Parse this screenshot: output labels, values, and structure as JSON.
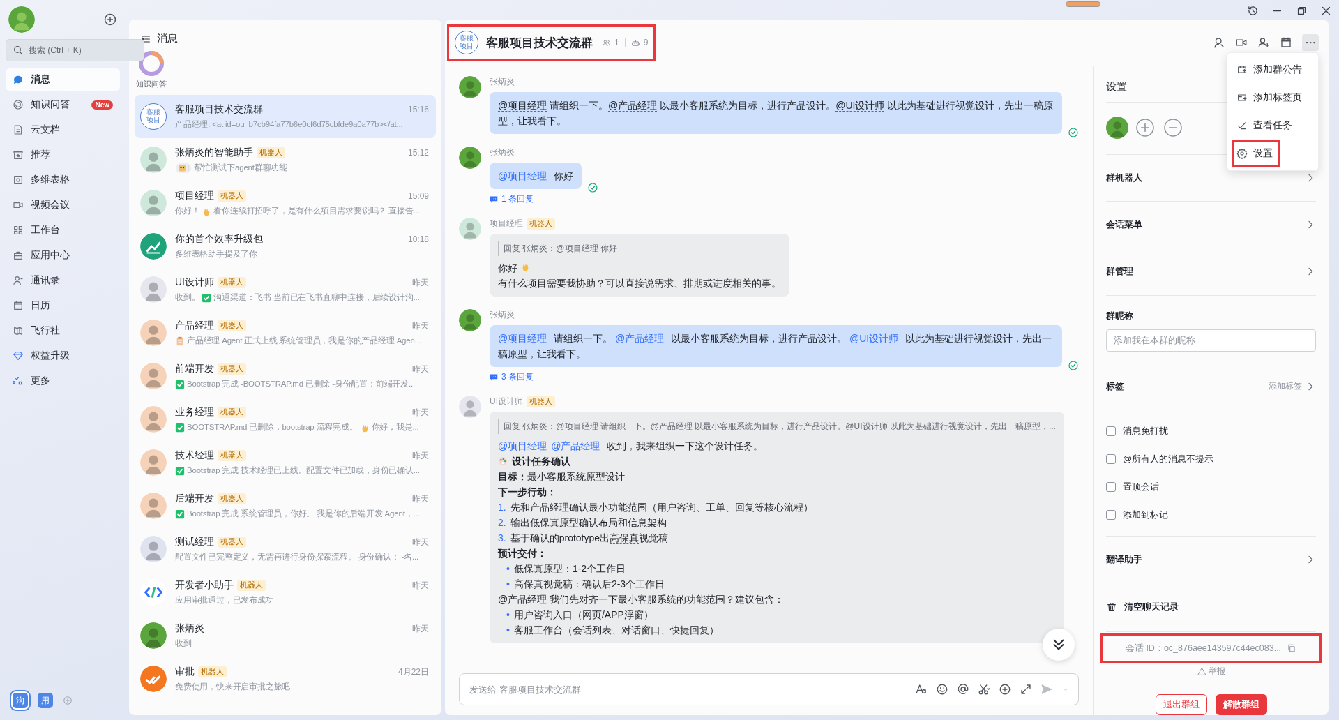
{
  "nav": {
    "search": {
      "placeholder": "搜索 (Ctrl + K)"
    },
    "items": [
      {
        "label": "消息",
        "selected": true
      },
      {
        "label": "知识问答",
        "selected": false,
        "badge": "New"
      },
      {
        "label": "云文档",
        "selected": false
      },
      {
        "label": "推荐",
        "selected": false
      },
      {
        "label": "多维表格",
        "selected": false
      },
      {
        "label": "视频会议",
        "selected": false
      },
      {
        "label": "工作台",
        "selected": false
      },
      {
        "label": "应用中心",
        "selected": false
      },
      {
        "label": "通讯录",
        "selected": false
      },
      {
        "label": "日历",
        "selected": false
      },
      {
        "label": "飞行社",
        "selected": false
      },
      {
        "label": "权益升级",
        "selected": false
      },
      {
        "label": "更多",
        "selected": false
      }
    ],
    "workspaces": [
      {
        "label": "沟",
        "selected": true
      },
      {
        "label": "用",
        "selected": false
      }
    ]
  },
  "list": {
    "title": "消息",
    "pinned": [
      {
        "label": "知识问答"
      }
    ],
    "conversations": [
      {
        "name": "客服项目技术交流群",
        "time": "15:16",
        "selected": true,
        "avatar": {
          "kind": "group",
          "lines": [
            "客服",
            "项目"
          ]
        },
        "preview": [
          {
            "kind": "text",
            "text": "产品经理: <at id=ou_b7cb94fa77b6e0cf6d75cbfde9a0a77b></at..."
          }
        ]
      },
      {
        "name": "张炳炎的智能助手",
        "tag": "机器人",
        "time": "15:12",
        "selected": false,
        "avatar": {
          "kind": "figure",
          "color": "#cfe8dc"
        },
        "preview": [
          {
            "kind": "bot"
          },
          {
            "kind": "text",
            "text": "帮忙测试下agent群聊功能"
          }
        ]
      },
      {
        "name": "项目经理",
        "tag": "机器人",
        "time": "15:09",
        "selected": false,
        "avatar": {
          "kind": "figure",
          "color": "#cfe8dc"
        },
        "preview": [
          {
            "kind": "text",
            "text": "你好！"
          },
          {
            "kind": "wave"
          },
          {
            "kind": "text",
            "text": "看你连续打招呼了，是有什么项目需求要说吗？ 直接告..."
          }
        ]
      },
      {
        "name": "你的首个效率升级包",
        "time": "10:18",
        "selected": false,
        "avatar": {
          "kind": "chart"
        },
        "preview": [
          {
            "kind": "text",
            "text": "多维表格助手提及了你"
          }
        ]
      },
      {
        "name": "UI设计师",
        "tag": "机器人",
        "time": "昨天",
        "selected": false,
        "avatar": {
          "kind": "figure",
          "color": "#e6e6ee"
        },
        "preview": [
          {
            "kind": "text",
            "text": "收到。"
          },
          {
            "kind": "check"
          },
          {
            "kind": "text",
            "text": "沟通渠道：飞书 当前已在飞书直聊中连接，后续设计沟..."
          }
        ]
      },
      {
        "name": "产品经理",
        "tag": "机器人",
        "time": "昨天",
        "selected": false,
        "avatar": {
          "kind": "figure",
          "color": "#f5d2b8"
        },
        "preview": [
          {
            "kind": "doc"
          },
          {
            "kind": "text",
            "text": "产品经理 Agent 正式上线 系统管理员，我是你的产品经理 Agen..."
          }
        ]
      },
      {
        "name": "前端开发",
        "tag": "机器人",
        "time": "昨天",
        "selected": false,
        "avatar": {
          "kind": "figure",
          "color": "#f5d2b8"
        },
        "preview": [
          {
            "kind": "check"
          },
          {
            "kind": "text",
            "text": "Bootstrap 完成 -BOOTSTRAP.md 已删除 -身份配置：前端开发..."
          }
        ]
      },
      {
        "name": "业务经理",
        "tag": "机器人",
        "time": "昨天",
        "selected": false,
        "avatar": {
          "kind": "figure",
          "color": "#f5d2b8"
        },
        "preview": [
          {
            "kind": "check"
          },
          {
            "kind": "text",
            "text": "BOOTSTRAP.md 已删除，bootstrap 流程完成。"
          },
          {
            "kind": "wave"
          },
          {
            "kind": "text",
            "text": "你好，我是..."
          }
        ]
      },
      {
        "name": "技术经理",
        "tag": "机器人",
        "time": "昨天",
        "selected": false,
        "avatar": {
          "kind": "figure",
          "color": "#f5d2b8"
        },
        "preview": [
          {
            "kind": "check"
          },
          {
            "kind": "text",
            "text": "Bootstrap 完成 技术经理已上线。配置文件已加载，身份已确认..."
          }
        ]
      },
      {
        "name": "后端开发",
        "tag": "机器人",
        "time": "昨天",
        "selected": false,
        "avatar": {
          "kind": "figure",
          "color": "#f5d2b8"
        },
        "preview": [
          {
            "kind": "check"
          },
          {
            "kind": "text",
            "text": "Bootstrap 完成 系统管理员，你好。 我是你的后端开发 Agent，..."
          }
        ]
      },
      {
        "name": "测试经理",
        "tag": "机器人",
        "time": "昨天",
        "selected": false,
        "avatar": {
          "kind": "figure",
          "color": "#dfe3f0"
        },
        "preview": [
          {
            "kind": "text",
            "text": "配置文件已完整定义，无需再进行身份探索流程。 身份确认： -名..."
          }
        ]
      },
      {
        "name": "开发者小助手",
        "tag": "机器人",
        "time": "昨天",
        "selected": false,
        "avatar": {
          "kind": "code"
        },
        "preview": [
          {
            "kind": "text",
            "text": "应用审批通过，已发布成功"
          }
        ]
      },
      {
        "name": "张炳炎",
        "time": "昨天",
        "selected": false,
        "avatar": {
          "kind": "figure",
          "color": "#5aa63c"
        },
        "preview": [
          {
            "kind": "text",
            "text": "收到"
          }
        ]
      },
      {
        "name": "审批",
        "tag": "机器人",
        "time": "4月22日",
        "selected": false,
        "avatar": {
          "kind": "approval"
        },
        "preview": [
          {
            "kind": "text",
            "text": "免费使用，快来开启审批之旅吧"
          }
        ]
      }
    ]
  },
  "chat": {
    "title": "客服项目技术交流群",
    "avatar_lines": [
      "客服",
      "项目"
    ],
    "members": "1",
    "bots": "9",
    "highlighted": true,
    "messages": [
      {
        "sender": "张炳炎",
        "kind": "self",
        "avatar": {
          "color": "#5aa63c"
        },
        "read": true,
        "blocks": [
          {
            "kind": "para",
            "segments": [
              {
                "kind": "dotted",
                "text": "@项目经理"
              },
              {
                "kind": "text",
                "text": " 请组织一下。"
              },
              {
                "kind": "dotted",
                "text": "@产品经理"
              },
              {
                "kind": "text",
                "text": " 以最小客服系统为目标，进行产品设计。"
              },
              {
                "kind": "dotted",
                "text": "@UI设计师"
              },
              {
                "kind": "text",
                "text": " 以此为基础进行视觉设计，先出一稿原型，让我看下。"
              }
            ]
          }
        ]
      },
      {
        "sender": "张炳炎",
        "kind": "self",
        "avatar": {
          "color": "#5aa63c"
        },
        "read": true,
        "replies": "1 条回复",
        "blocks": [
          {
            "kind": "para",
            "segments": [
              {
                "kind": "mention",
                "text": "@项目经理"
              },
              {
                "kind": "text",
                "text": " 你好"
              }
            ]
          }
        ]
      },
      {
        "sender": "项目经理",
        "tag": "机器人",
        "kind": "other",
        "avatar": {
          "color": "#cfe8dc"
        },
        "read": false,
        "quote": "回复 张炳炎：@项目经理 你好",
        "blocks": [
          {
            "kind": "para",
            "segments": [
              {
                "kind": "text",
                "text": "你好 "
              },
              {
                "kind": "wave"
              }
            ]
          },
          {
            "kind": "para",
            "segments": [
              {
                "kind": "text",
                "text": "有什么项目需要我协助？可以直接说需求、排期或进度相关的事。"
              }
            ]
          }
        ]
      },
      {
        "sender": "张炳炎",
        "kind": "self",
        "avatar": {
          "color": "#5aa63c"
        },
        "read": true,
        "replies": "3 条回复",
        "blocks": [
          {
            "kind": "para",
            "segments": [
              {
                "kind": "mention",
                "text": "@项目经理"
              },
              {
                "kind": "text",
                "text": "  请组织一下。 "
              },
              {
                "kind": "mention",
                "text": "@产品经理"
              },
              {
                "kind": "text",
                "text": " 以最小客服系统为目标，进行产品设计。 "
              },
              {
                "kind": "mention",
                "text": "@UI设计师"
              },
              {
                "kind": "text",
                "text": " 以此为基础进行视觉设计，先出一稿原型，让我看下。"
              }
            ]
          }
        ]
      },
      {
        "sender": "UI设计师",
        "tag": "机器人",
        "kind": "other",
        "avatar": {
          "color": "#e6e6ee"
        },
        "read": false,
        "quote": "回复 张炳炎：@项目经理 请组织一下。@产品经理 以最小客服系统为目标，进行产品设计。@UI设计师 以此为基础进行视觉设计，先出一稿原型，...",
        "blocks": [
          {
            "kind": "para",
            "segments": [
              {
                "kind": "mention",
                "text": "@项目经理"
              },
              {
                "kind": "mention",
                "text": "@产品经理"
              },
              {
                "kind": "text",
                "text": " 收到，我来组织一下这个设计任务。"
              }
            ]
          },
          {
            "kind": "para",
            "segments": [
              {
                "kind": "palette"
              },
              {
                "kind": "bold",
                "text": "设计任务确认"
              }
            ]
          },
          {
            "kind": "para",
            "segments": [
              {
                "kind": "bold",
                "text": "目标："
              },
              {
                "kind": "text",
                "text": "最小客服系统原型设计"
              }
            ]
          },
          {
            "kind": "para",
            "segments": [
              {
                "kind": "bold",
                "text": "下一步行动："
              }
            ]
          },
          {
            "kind": "numbered",
            "marker": "1.",
            "segments": [
              {
                "kind": "text",
                "text": "先和"
              },
              {
                "kind": "dotted",
                "text": "产品经理"
              },
              {
                "kind": "text",
                "text": "确认最小功能范围（用户咨询、工单、回复等核心流程）"
              }
            ]
          },
          {
            "kind": "numbered",
            "marker": "2.",
            "segments": [
              {
                "kind": "text",
                "text": "输出低保真原型确认布局和信息架构"
              }
            ]
          },
          {
            "kind": "numbered",
            "marker": "3.",
            "segments": [
              {
                "kind": "text",
                "text": "基于确认的prototype出"
              },
              {
                "kind": "dotted",
                "text": "高保真"
              },
              {
                "kind": "text",
                "text": "视觉稿"
              }
            ]
          },
          {
            "kind": "para",
            "segments": [
              {
                "kind": "bold",
                "text": "预计交付："
              }
            ]
          },
          {
            "kind": "bullet",
            "marker": "•",
            "segments": [
              {
                "kind": "text",
                "text": "低保真原型：1-2个工作日"
              }
            ]
          },
          {
            "kind": "bullet",
            "marker": "•",
            "segments": [
              {
                "kind": "text",
                "text": "高保真视觉稿：确认后2-3个工作日"
              }
            ]
          },
          {
            "kind": "para",
            "segments": [
              {
                "kind": "text",
                "text": "@产品经理 我们先对齐一下最小客服系统的功能范围？建议包含："
              }
            ]
          },
          {
            "kind": "bullet",
            "marker": "•",
            "segments": [
              {
                "kind": "text",
                "text": "用户咨询入口（网页/APP浮窗）"
              }
            ]
          },
          {
            "kind": "bullet",
            "marker": "•",
            "segments": [
              {
                "kind": "dotted",
                "text": "客服工作台"
              },
              {
                "kind": "text",
                "text": "（会话列表、对话窗口、快捷回复）"
              }
            ]
          }
        ]
      }
    ],
    "composer": {
      "placeholder": "发送给 客服项目技术交流群"
    }
  },
  "menu": [
    {
      "label": "添加群公告",
      "highlighted": false
    },
    {
      "label": "添加标签页",
      "highlighted": false
    },
    {
      "label": "查看任务",
      "highlighted": false
    },
    {
      "label": "设置",
      "highlighted": true
    }
  ],
  "settings": {
    "title": "设置",
    "members": [
      {
        "color": "#5aa63c"
      }
    ],
    "rows": [
      {
        "kind": "link",
        "label": "群机器人"
      },
      {
        "kind": "link",
        "label": "会话菜单"
      },
      {
        "kind": "link",
        "label": "群管理"
      },
      {
        "kind": "field",
        "label": "群昵称",
        "placeholder": "添加我在本群的昵称"
      },
      {
        "kind": "link",
        "label": "标签",
        "action": "添加标签"
      },
      {
        "kind": "checks",
        "items": [
          {
            "label": "消息免打扰",
            "checked": false
          },
          {
            "label": "@所有人的消息不提示",
            "checked": false
          },
          {
            "label": "置顶会话",
            "checked": false
          },
          {
            "label": "添加到标记",
            "checked": false
          }
        ]
      },
      {
        "kind": "link",
        "label": "翻译助手"
      },
      {
        "kind": "danger",
        "label": "清空聊天记录"
      }
    ],
    "session_id": {
      "text": "会话 ID：oc_876aee143597c44ec083...",
      "highlighted": true
    },
    "report": "举报",
    "buttons": [
      {
        "label": "退出群组",
        "kind": "outline"
      },
      {
        "label": "解散群组",
        "kind": "filled"
      }
    ]
  }
}
